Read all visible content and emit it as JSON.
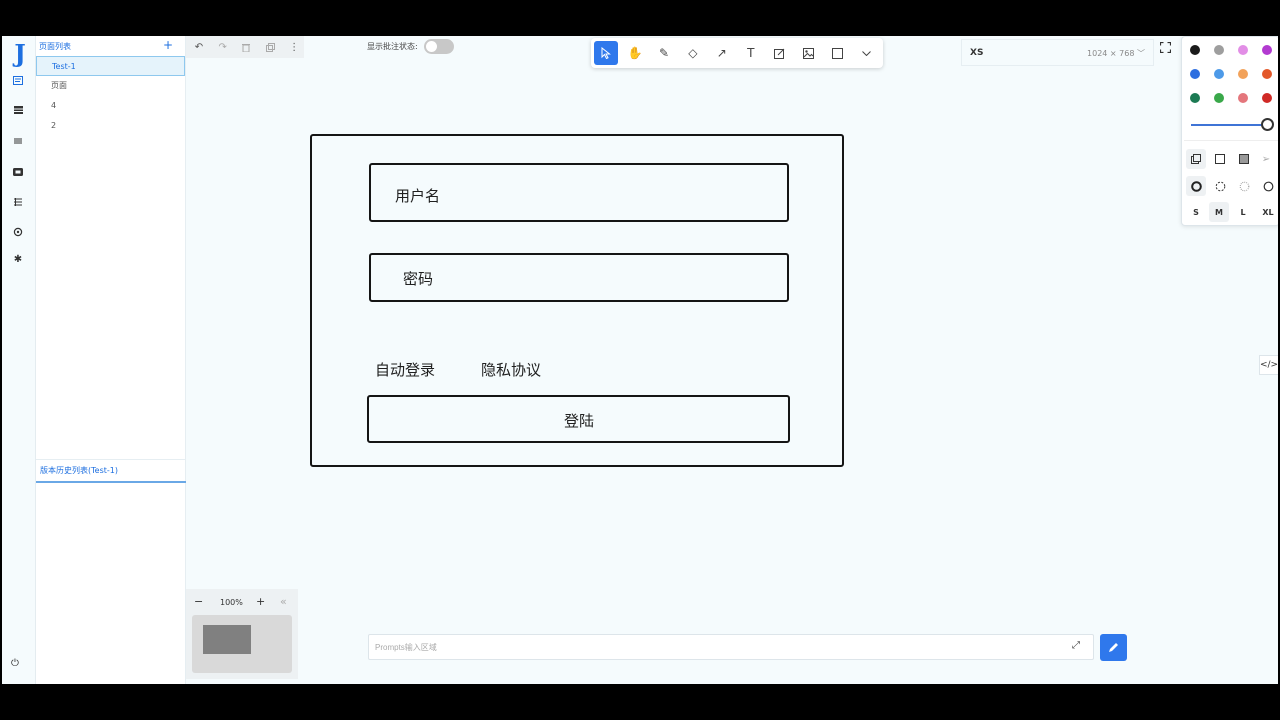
{
  "rail": {
    "icons": [
      "logo",
      "pages-icon",
      "list-icon",
      "menu-icon",
      "video-icon",
      "layers-icon",
      "settings-icon",
      "gear-icon",
      "power-icon"
    ]
  },
  "page_list": {
    "title": "页面列表",
    "add_label": "+",
    "items": [
      "Test-1",
      "页面",
      "4",
      "2"
    ],
    "active_index": 0,
    "history_label": "版本历史列表(Test-1)"
  },
  "toolbar": {
    "annotation_label": "显示批注状态:",
    "annotation_enabled": false
  },
  "draw_tools": {
    "items": [
      "select",
      "hand",
      "pencil",
      "eraser",
      "arrow",
      "text",
      "note",
      "image",
      "rectangle",
      "more"
    ],
    "selected": "select"
  },
  "viewport": {
    "size_name": "XS",
    "size_dim": "1024 × 768",
    "chevron": "﹀"
  },
  "style_panel": {
    "colors": [
      "#1a1a1a",
      "#9e9e9e",
      "#e28ee6",
      "#b23ad0",
      "#2d6ee0",
      "#4d9ae8",
      "#f2a25a",
      "#e3582a",
      "#1c7a53",
      "#3aa84a",
      "#e4767c",
      "#d02a26"
    ],
    "stroke_sizes": [
      "S",
      "M",
      "L",
      "XL"
    ],
    "selected_size": "M",
    "slider_value": 1.0
  },
  "canvas": {
    "username_label": "用户名",
    "password_label": "密码",
    "auto_login_label": "自动登录",
    "privacy_label": "隐私协议",
    "login_button_label": "登陆"
  },
  "zoom": {
    "minus": "−",
    "level": "100%",
    "plus": "+",
    "collapse": "«"
  },
  "prompt": {
    "placeholder": "Prompts输入区域",
    "value": ""
  }
}
